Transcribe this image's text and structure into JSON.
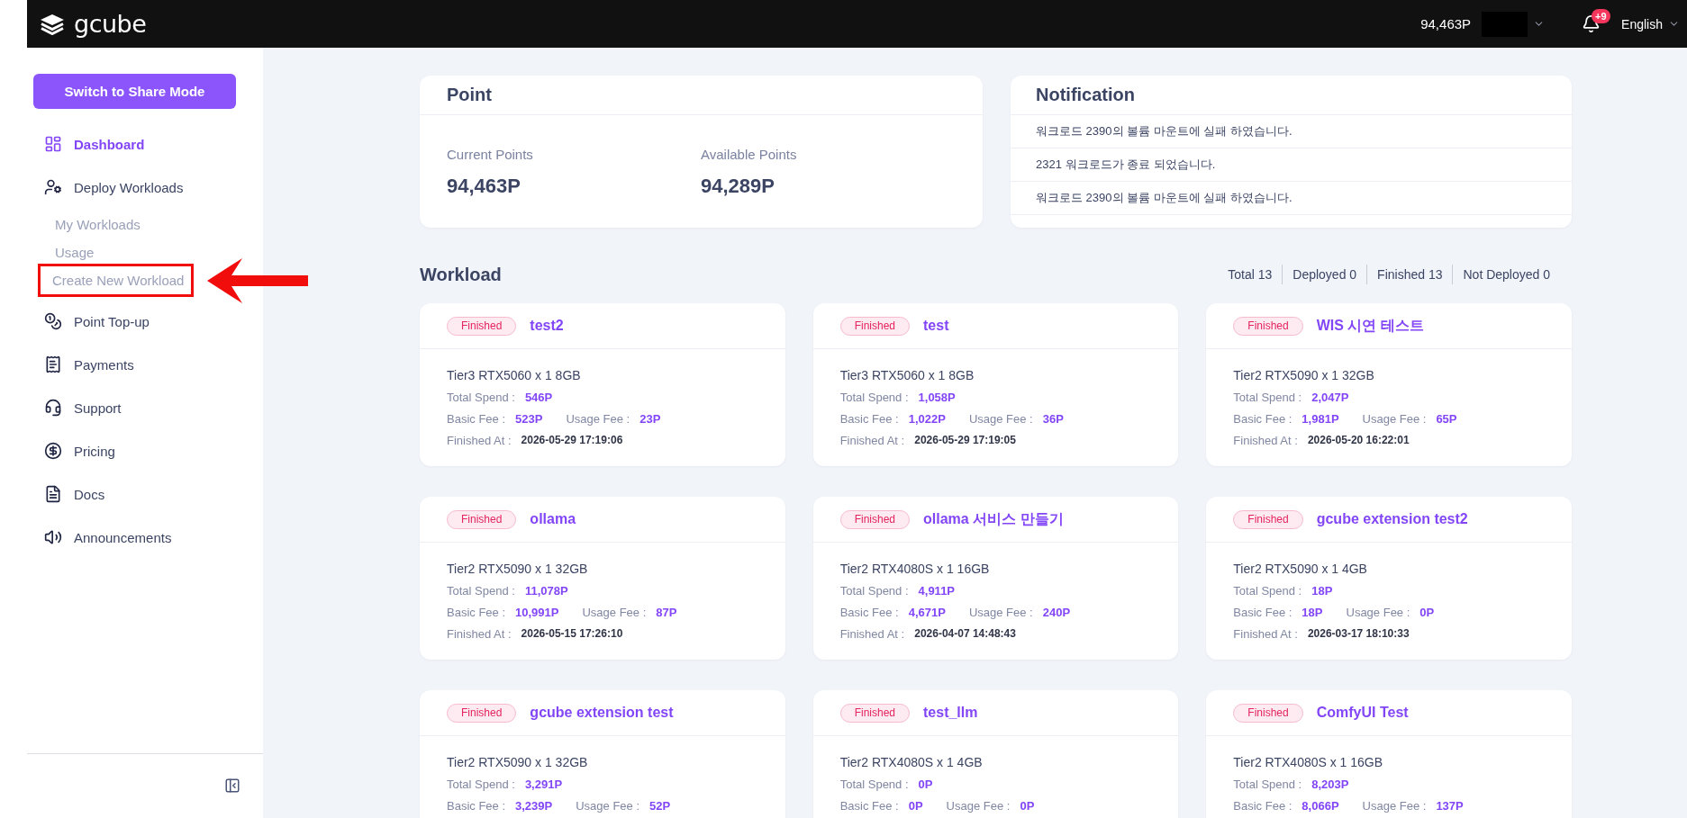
{
  "header": {
    "logo_text": "gcube",
    "points": "94,463P",
    "notification_badge": "+9",
    "language": "English"
  },
  "sidebar": {
    "mode_button": "Switch to Share Mode",
    "items": [
      {
        "label": "Dashboard",
        "selected": true
      },
      {
        "label": "Deploy Workloads",
        "selected": false,
        "children": [
          {
            "label": "My Workloads",
            "selected": false,
            "highlighted": false
          },
          {
            "label": "Usage",
            "selected": false,
            "highlighted": false
          },
          {
            "label": "Create New Workload",
            "selected": false,
            "highlighted": true
          }
        ]
      },
      {
        "label": "Point Top-up",
        "selected": false
      },
      {
        "label": "Payments",
        "selected": false
      },
      {
        "label": "Support",
        "selected": false
      },
      {
        "label": "Pricing",
        "selected": false
      },
      {
        "label": "Docs",
        "selected": false
      },
      {
        "label": "Announcements",
        "selected": false
      }
    ]
  },
  "point_card": {
    "title": "Point",
    "stats": [
      {
        "label": "Current Points",
        "value": "94,463P"
      },
      {
        "label": "Available Points",
        "value": "94,289P"
      }
    ]
  },
  "notification_card": {
    "title": "Notification",
    "items": [
      "워크로드 2390의 볼륨 마운트에 실패 하였습니다.",
      "2321 워크로드가 종료 되었습니다.",
      "워크로드 2390의 볼륨 마운트에 실패 하였습니다."
    ]
  },
  "workload": {
    "title": "Workload",
    "summary": [
      "Total 13",
      "Deployed 0",
      "Finished 13",
      "Not Deployed 0"
    ],
    "cards": [
      {
        "status": "Finished",
        "name": "test2",
        "spec": "Tier3 RTX5060 x 1 8GB",
        "total_spend": {
          "label": "Total Spend :",
          "value": "546P"
        },
        "fees": [
          {
            "label": "Basic Fee :",
            "value": "523P"
          },
          {
            "label": "Usage Fee :",
            "value": "23P"
          }
        ],
        "finished_at": {
          "label": "Finished At :",
          "value": "2026-05-29 17:19:06"
        }
      },
      {
        "status": "Finished",
        "name": "test",
        "spec": "Tier3 RTX5060 x 1 8GB",
        "total_spend": {
          "label": "Total Spend :",
          "value": "1,058P"
        },
        "fees": [
          {
            "label": "Basic Fee :",
            "value": "1,022P"
          },
          {
            "label": "Usage Fee :",
            "value": "36P"
          }
        ],
        "finished_at": {
          "label": "Finished At :",
          "value": "2026-05-29 17:19:05"
        }
      },
      {
        "status": "Finished",
        "name": "WIS 시연 테스트",
        "spec": "Tier2 RTX5090 x 1 32GB",
        "total_spend": {
          "label": "Total Spend :",
          "value": "2,047P"
        },
        "fees": [
          {
            "label": "Basic Fee :",
            "value": "1,981P"
          },
          {
            "label": "Usage Fee :",
            "value": "65P"
          }
        ],
        "finished_at": {
          "label": "Finished At :",
          "value": "2026-05-20 16:22:01"
        }
      },
      {
        "status": "Finished",
        "name": "ollama",
        "spec": "Tier2 RTX5090 x 1 32GB",
        "total_spend": {
          "label": "Total Spend :",
          "value": "11,078P"
        },
        "fees": [
          {
            "label": "Basic Fee :",
            "value": "10,991P"
          },
          {
            "label": "Usage Fee :",
            "value": "87P"
          }
        ],
        "finished_at": {
          "label": "Finished At :",
          "value": "2026-05-15 17:26:10"
        }
      },
      {
        "status": "Finished",
        "name": "ollama 서비스 만들기",
        "spec": "Tier2 RTX4080S x 1 16GB",
        "total_spend": {
          "label": "Total Spend :",
          "value": "4,911P"
        },
        "fees": [
          {
            "label": "Basic Fee :",
            "value": "4,671P"
          },
          {
            "label": "Usage Fee :",
            "value": "240P"
          }
        ],
        "finished_at": {
          "label": "Finished At :",
          "value": "2026-04-07 14:48:43"
        }
      },
      {
        "status": "Finished",
        "name": "gcube extension test2",
        "spec": "Tier2 RTX5090 x 1 4GB",
        "total_spend": {
          "label": "Total Spend :",
          "value": "18P"
        },
        "fees": [
          {
            "label": "Basic Fee :",
            "value": "18P"
          },
          {
            "label": "Usage Fee :",
            "value": "0P"
          }
        ],
        "finished_at": {
          "label": "Finished At :",
          "value": "2026-03-17 18:10:33"
        }
      },
      {
        "status": "Finished",
        "name": "gcube extension test",
        "spec": "Tier2 RTX5090 x 1 32GB",
        "total_spend": {
          "label": "Total Spend :",
          "value": "3,291P"
        },
        "fees": [
          {
            "label": "Basic Fee :",
            "value": "3,239P"
          },
          {
            "label": "Usage Fee :",
            "value": "52P"
          }
        ]
      },
      {
        "status": "Finished",
        "name": "test_llm",
        "spec": "Tier2 RTX4080S x 1 4GB",
        "total_spend": {
          "label": "Total Spend :",
          "value": "0P"
        },
        "fees": [
          {
            "label": "Basic Fee :",
            "value": "0P"
          },
          {
            "label": "Usage Fee :",
            "value": "0P"
          }
        ]
      },
      {
        "status": "Finished",
        "name": "ComfyUI Test",
        "spec": "Tier2 RTX4080S x 1 16GB",
        "total_spend": {
          "label": "Total Spend :",
          "value": "8,203P"
        },
        "fees": [
          {
            "label": "Basic Fee :",
            "value": "8,066P"
          },
          {
            "label": "Usage Fee :",
            "value": "137P"
          }
        ]
      }
    ]
  }
}
